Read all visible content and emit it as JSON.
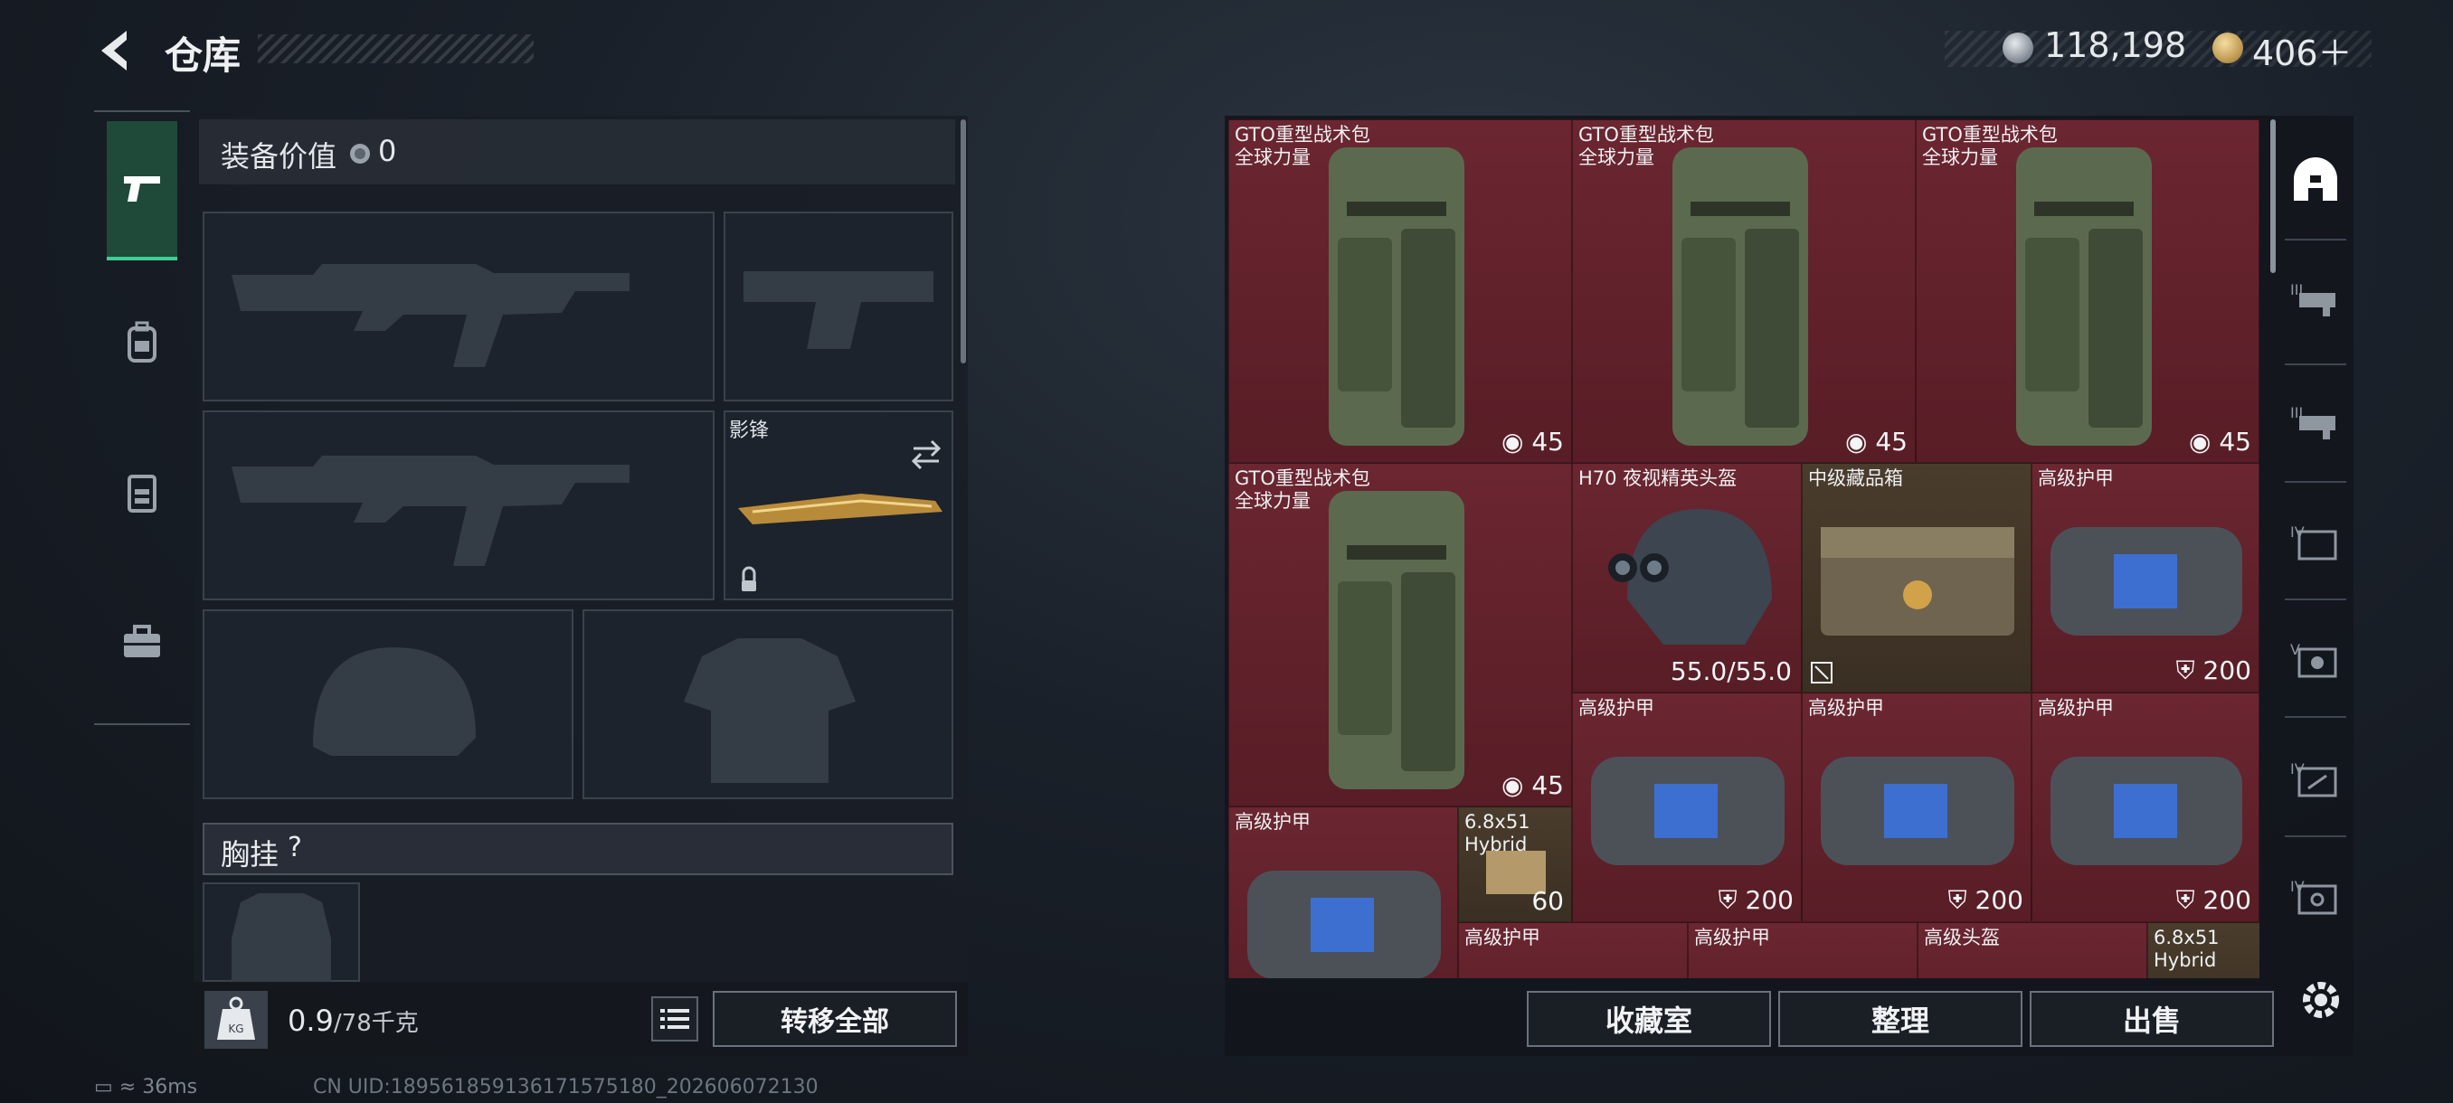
{
  "header": {
    "title": "仓库",
    "currency1": "118,198",
    "currency2": "406＋"
  },
  "left_tabs": [
    "weapon-tab",
    "backpack-tab",
    "chest-rig-tab",
    "toolbox-tab"
  ],
  "equipment": {
    "value_label": "装备价值",
    "value": "0",
    "knife_name": "影锋",
    "chest_label": "胸挂",
    "chest_help": "?",
    "weight_current": "0.9",
    "weight_max": "/78千克",
    "transfer_all": "转移全部"
  },
  "storage": {
    "items": [
      {
        "name": "GTO重型战术包\n全球力量",
        "qty": "45",
        "qty_icon": "backpack"
      },
      {
        "name": "GTO重型战术包\n全球力量",
        "qty": "45",
        "qty_icon": "backpack"
      },
      {
        "name": "GTO重型战术包\n全球力量",
        "qty": "45",
        "qty_icon": "backpack"
      },
      {
        "name": "GTO重型战术包\n全球力量",
        "qty": "45",
        "qty_icon": "backpack"
      },
      {
        "name": "H70 夜视精英头盔",
        "qty": "55.0/55.0",
        "qty_icon": "durability"
      },
      {
        "name": "中级藏品箱",
        "qty": "",
        "qty_icon": "resize"
      },
      {
        "name": "高级护甲",
        "qty": "200",
        "qty_icon": "shield"
      },
      {
        "name": "高级护甲",
        "qty": "200",
        "qty_icon": "shield"
      },
      {
        "name": "高级护甲",
        "qty": "200",
        "qty_icon": "shield"
      },
      {
        "name": "高级护甲",
        "qty": "200",
        "qty_icon": "shield"
      },
      {
        "name": "高级护甲",
        "qty": "",
        "qty_icon": ""
      },
      {
        "name": "6.8x51\nHybrid",
        "qty": "60",
        "qty_icon": ""
      },
      {
        "name": "高级护甲",
        "qty": "",
        "qty_icon": ""
      },
      {
        "name": "高级护甲",
        "qty": "",
        "qty_icon": ""
      },
      {
        "name": "高级头盔",
        "qty": "",
        "qty_icon": ""
      },
      {
        "name": "6.8x51\nHybrid",
        "qty": "",
        "qty_icon": ""
      }
    ],
    "filters": [
      "home-icon",
      "tier-III-icon",
      "tier-III-icon",
      "tier-IV-icon",
      "tier-V-icon",
      "tier-IV-icon",
      "tier-IV-icon"
    ],
    "tier_labels": [
      "III",
      "III",
      "IV",
      "V",
      "IV",
      "IV"
    ],
    "collection": "收藏室",
    "sort": "整理",
    "sell": "出售"
  },
  "statusbar": {
    "ping": "36ms",
    "uid": "CN UID:189561859136171575180_202606072130"
  },
  "colors": {
    "grid_cell": "#5c1f27",
    "accent_green": "#3fcf94",
    "gold_cell": "#3a2f23"
  }
}
